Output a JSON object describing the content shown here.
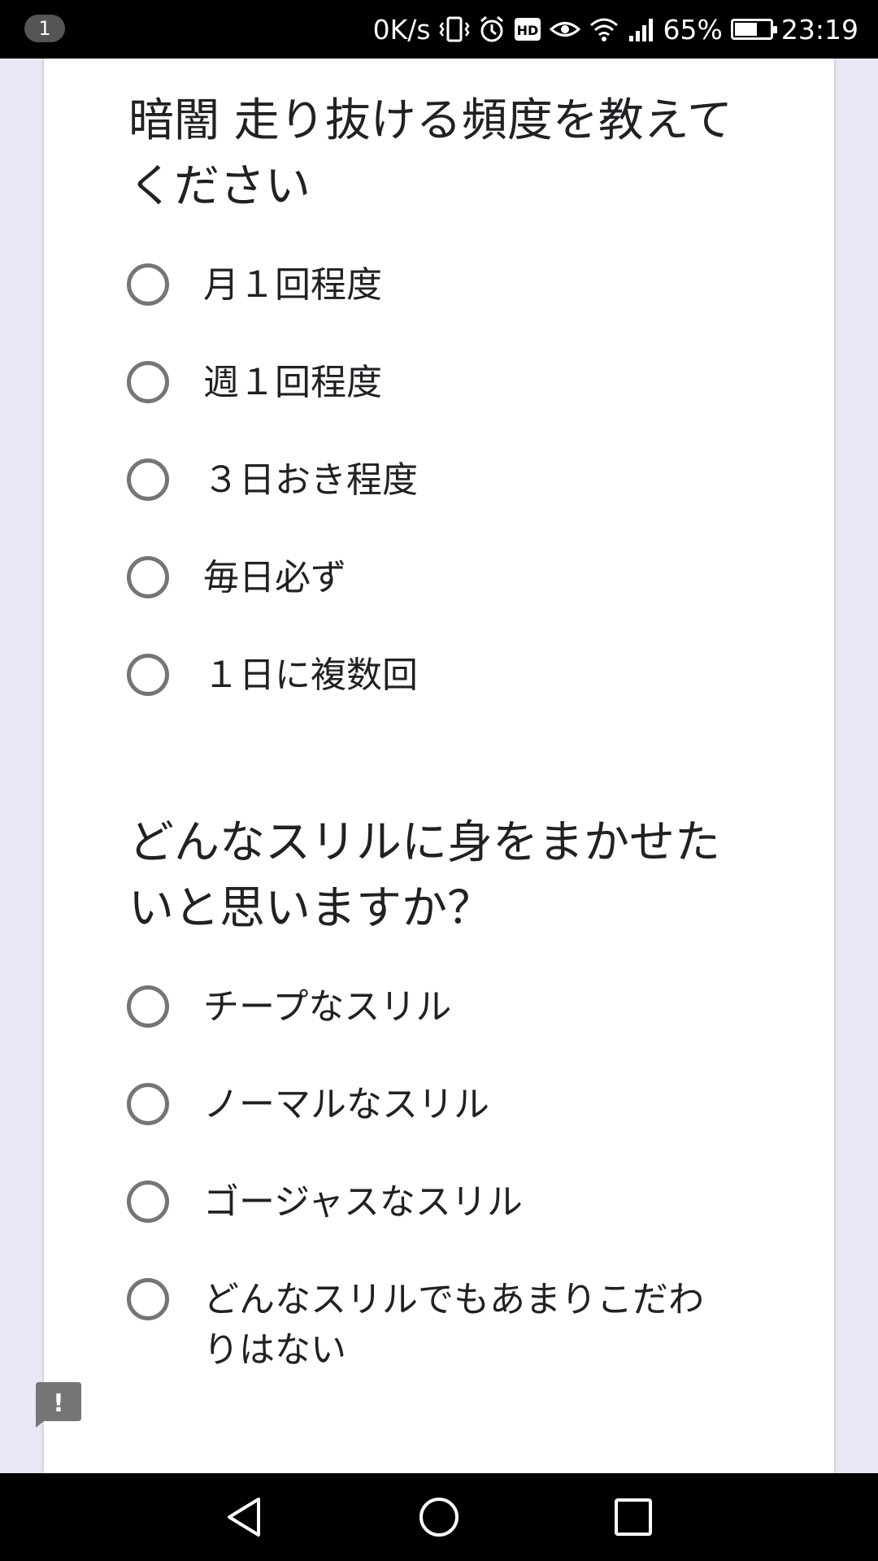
{
  "status_bar": {
    "notification_count": "1",
    "network_speed": "0K/s",
    "battery_percent": "65%",
    "battery_level": 0.65,
    "time": "23:19",
    "icons": [
      "vibrate-icon",
      "alarm-icon",
      "hd-icon",
      "eye-icon",
      "wifi-icon",
      "signal-icon",
      "battery-icon"
    ]
  },
  "form": {
    "questions": [
      {
        "title": "暗闇 走り抜ける頻度を教えてください",
        "options": [
          "月１回程度",
          "週１回程度",
          "３日おき程度",
          "毎日必ず",
          "１日に複数回"
        ]
      },
      {
        "title": "どんなスリルに身をまかせたいと思いますか？",
        "options": [
          "チープなスリル",
          "ノーマルなスリル",
          "ゴージャスなスリル",
          "どんなスリルでもあまりこだわりはない"
        ]
      }
    ]
  },
  "feedback": {
    "icon": "report-feedback-icon",
    "glyph": "!"
  },
  "nav_bar": {
    "buttons": [
      "back-icon",
      "home-icon",
      "recents-icon"
    ]
  },
  "colors": {
    "background": "#ece7f4",
    "card": "#ffffff",
    "radio_border": "#757575",
    "text": "#202124"
  }
}
